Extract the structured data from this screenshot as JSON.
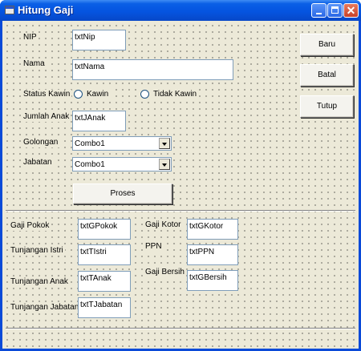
{
  "window": {
    "title": "Hitung Gaji"
  },
  "fields": {
    "nip": {
      "label": "NIP",
      "value": "txtNip"
    },
    "nama": {
      "label": "Nama",
      "value": "txtNama"
    },
    "jumlah_anak": {
      "label": "Jumlah Anak",
      "value": "txtJAnak"
    }
  },
  "status_kawin": {
    "label": "Status Kawin",
    "option_kawin": "Kawin",
    "option_tidak_kawin": "Tidak Kawin"
  },
  "golongan": {
    "label": "Golongan",
    "value": "Combo1"
  },
  "jabatan": {
    "label": "Jabatan",
    "value": "Combo1"
  },
  "buttons": {
    "baru": "Baru",
    "batal": "Batal",
    "tutup": "Tutup",
    "proses": "Proses"
  },
  "results": {
    "gaji_pokok": {
      "label": "Gaji Pokok",
      "value": "txtGPokok"
    },
    "tunjangan_istri": {
      "label": "Tunjangan Istri",
      "value": "txtTIstri"
    },
    "tunjangan_anak": {
      "label": "Tunjangan Anak",
      "value": "txtTAnak"
    },
    "tunjangan_jabatan": {
      "label": "Tunjangan Jabatan",
      "value": "txtTJabatan"
    },
    "gaji_kotor": {
      "label": "Gaji Kotor",
      "value": "txtGKotor"
    },
    "ppn": {
      "label": "PPN",
      "value": "txtPPN"
    },
    "gaji_bersih": {
      "label": "Gaji Bersih",
      "value": "txtGBersih"
    }
  }
}
